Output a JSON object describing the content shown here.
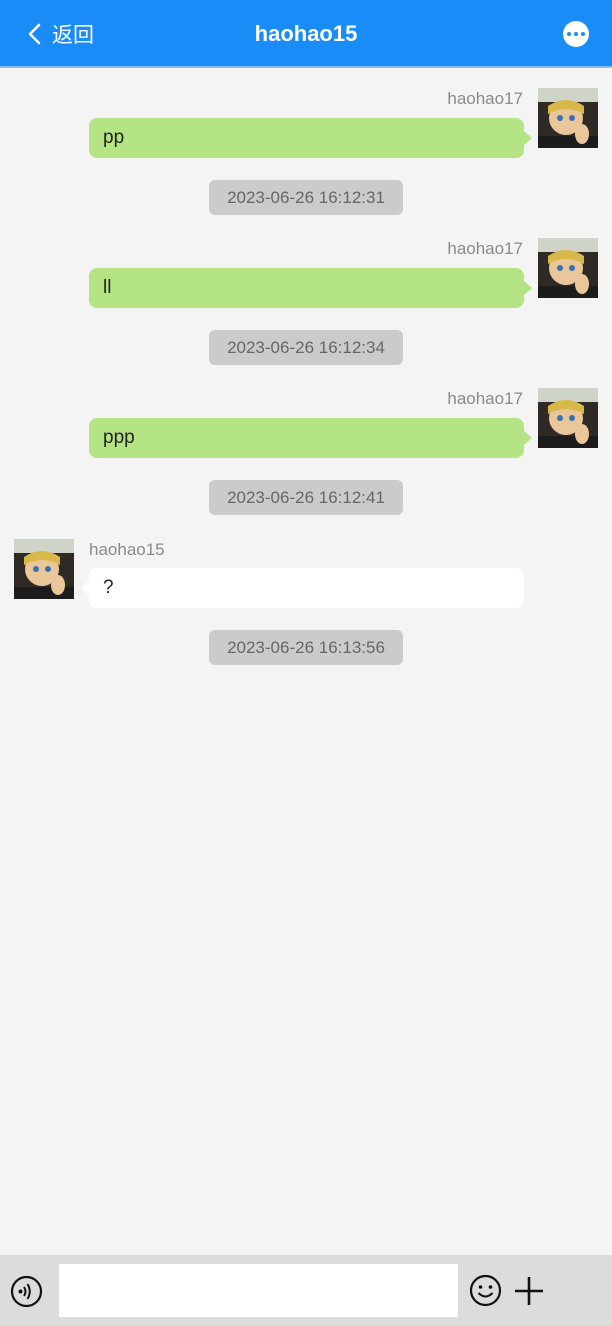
{
  "header": {
    "back_label": "返回",
    "title": "haohao15",
    "more_icon": "more-icon",
    "bg_color": "#1a8cf8"
  },
  "messages": [
    {
      "direction": "out",
      "sender": "haohao17",
      "text": "pp",
      "time": "2023-06-26 16:12:31"
    },
    {
      "direction": "out",
      "sender": "haohao17",
      "text": "ll",
      "time": "2023-06-26 16:12:34"
    },
    {
      "direction": "out",
      "sender": "haohao17",
      "text": "ppp",
      "time": "2023-06-26 16:12:41"
    },
    {
      "direction": "in",
      "sender": "haohao15",
      "text": "?",
      "time": "2023-06-26 16:13:56"
    }
  ],
  "footer": {
    "input_value": "",
    "voice_icon": "voice-icon",
    "emoji_icon": "emoji-icon",
    "plus_icon": "plus-icon"
  },
  "colors": {
    "outgoing_bubble": "#b5e484",
    "incoming_bubble": "#ffffff",
    "timestamp_bg": "#cbcbcb"
  }
}
